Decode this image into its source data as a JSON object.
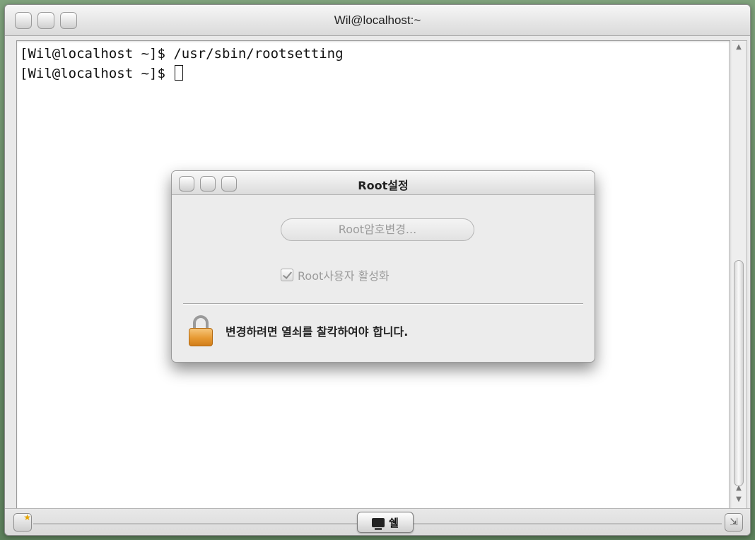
{
  "window": {
    "title": "Wil@localhost:~"
  },
  "terminal": {
    "lines": [
      "[Wil@localhost ~]$ /usr/sbin/rootsetting",
      "[Wil@localhost ~]$ "
    ]
  },
  "dialog": {
    "title": "Root설정",
    "change_password_button": "Root암호변경...",
    "enable_root_checkbox": {
      "label": "Root사용자 활성화",
      "checked": true
    },
    "lock_message": "변경하려면 열쇠를 찰칵하여야 합니다."
  },
  "bottombar": {
    "shell_tab_label": "쉘"
  },
  "icons": {
    "titlebar_buttons": [
      "close-icon",
      "minimize-icon",
      "zoom-icon"
    ],
    "lock": "lock-icon",
    "shell": "monitor-icon",
    "new_window": "new-window-icon",
    "resize": "resize-grip-icon"
  },
  "colors": {
    "lock_accent": "#e79a33",
    "desktop_bg": "#6c8f6a"
  }
}
